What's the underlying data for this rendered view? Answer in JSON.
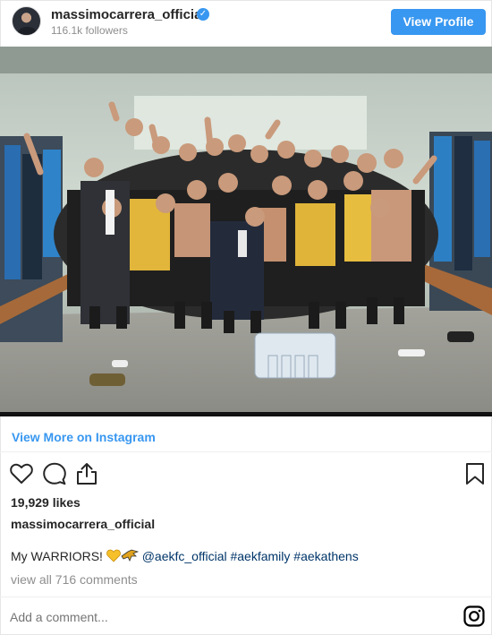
{
  "header": {
    "username": "massimocarrera_official",
    "followers": "116.1k followers",
    "view_profile": "View Profile"
  },
  "links": {
    "view_more": "View More on Instagram"
  },
  "post": {
    "likes": "19,929 likes",
    "author": "massimocarrera_official",
    "caption_text": "My WARRIORS!",
    "mention": "@aekfc_official",
    "hashtags": [
      "#aekfamily",
      "#aekathens"
    ],
    "view_comments": "view all 716 comments"
  },
  "comment": {
    "placeholder": "Add a comment..."
  },
  "icons": {
    "heart": "heart-icon",
    "comment": "comment-icon",
    "share": "share-icon",
    "bookmark": "bookmark-icon",
    "instagram": "instagram-icon",
    "verified": "verified-badge-icon"
  },
  "colors": {
    "accent": "#3897f0",
    "tag": "#003569",
    "muted": "#8e8e8e"
  }
}
